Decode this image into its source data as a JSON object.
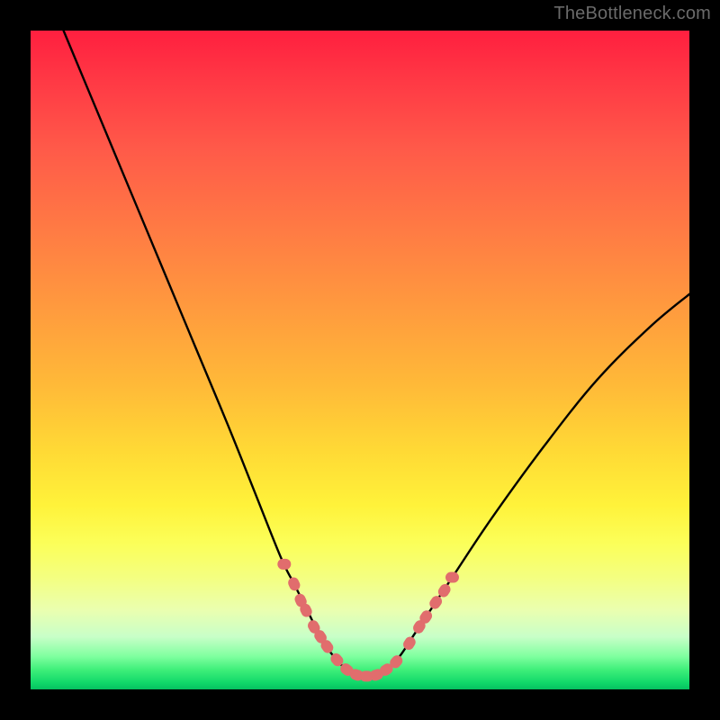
{
  "watermark": "TheBottleneck.com",
  "colors": {
    "frame": "#000000",
    "curve": "#000000",
    "dots": "#e16d6d"
  },
  "chart_data": {
    "type": "line",
    "title": "",
    "xlabel": "",
    "ylabel": "",
    "xlim": [
      0,
      100
    ],
    "ylim": [
      0,
      100
    ],
    "series": [
      {
        "name": "bottleneck-curve",
        "x": [
          5,
          10,
          15,
          20,
          25,
          30,
          34,
          38,
          40,
          42,
          44,
          46,
          48,
          50,
          52,
          54,
          56,
          58,
          60,
          64,
          70,
          78,
          86,
          94,
          100
        ],
        "y": [
          100,
          88,
          76,
          64,
          52,
          40,
          30,
          20,
          16,
          12,
          8,
          5,
          3,
          2,
          2,
          3,
          5,
          8,
          11,
          17,
          26,
          37,
          47,
          55,
          60
        ]
      }
    ],
    "markers": {
      "name": "highlight-dots",
      "x": [
        38.5,
        40.0,
        41.0,
        41.8,
        43.0,
        44.0,
        45.0,
        46.5,
        48.0,
        49.5,
        51.0,
        52.5,
        54.0,
        55.5,
        57.5,
        59.0,
        60.0,
        61.5,
        62.8,
        64.0
      ],
      "y": [
        19.0,
        16.0,
        13.5,
        12.0,
        9.5,
        8.0,
        6.5,
        4.5,
        3.0,
        2.2,
        2.0,
        2.2,
        3.0,
        4.2,
        7.0,
        9.5,
        11.0,
        13.2,
        15.0,
        17.0
      ]
    }
  }
}
